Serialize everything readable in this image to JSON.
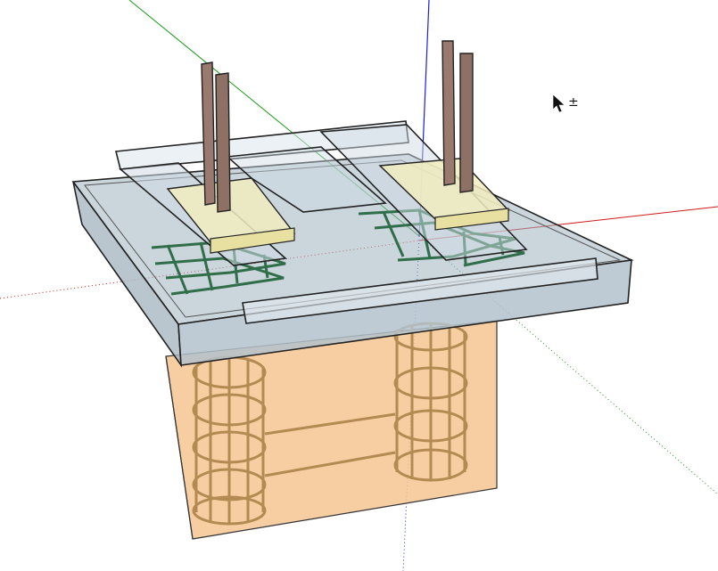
{
  "viewport": {
    "background": "#ffffff",
    "axes": {
      "red": "#d01818",
      "green": "#1a9a1a",
      "blue": "#1820e0"
    }
  },
  "model": {
    "concrete_color": "#f4c690",
    "slab_color": "#9fb3c0",
    "rebar_color": "#b38a52",
    "column_steel_color": "#9a7a6e",
    "mesh_color": "#2f6e48"
  },
  "cursor": {
    "icon": "select-arrow-icon",
    "modifier": "±"
  }
}
